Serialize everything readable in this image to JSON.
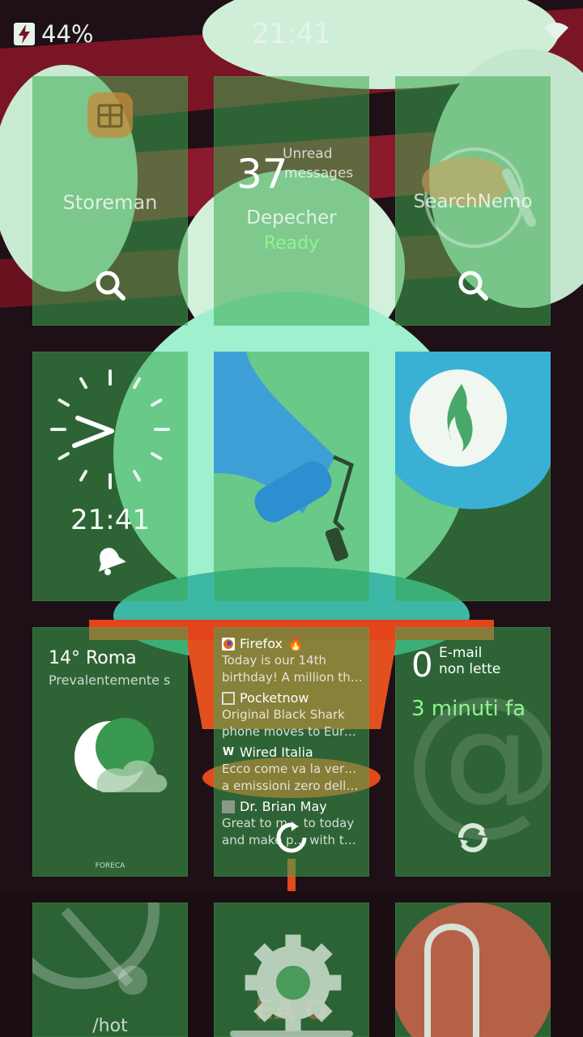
{
  "status_bar": {
    "battery": "44%",
    "time": "21:41"
  },
  "tiles": {
    "storeman": {
      "label": "Storeman"
    },
    "depecher": {
      "count": "37",
      "unread_line1": "Unread",
      "unread_line2": "messages",
      "name": "Depecher",
      "status": "Ready"
    },
    "searchnemo": {
      "label": "SearchNemo"
    },
    "clock": {
      "time": "21:41"
    },
    "weather": {
      "title": "14° Roma",
      "condition": "Prevalentemente s",
      "provider": "FORECA"
    },
    "feed": {
      "items": [
        {
          "source": "Firefox",
          "text1": "Today is our 14th",
          "text2": "birthday! A million than…"
        },
        {
          "source": "Pocketnow",
          "text1": "Original Black Shark",
          "text2": "phone moves to Europ…"
        },
        {
          "source": "Wired Italia",
          "text1": "Ecco come va la versione",
          "text2": "a emissioni zero dell…"
        },
        {
          "source": "Dr. Brian May",
          "text1": "Great to m… to today",
          "text2": "and make p… with th…"
        }
      ]
    },
    "email": {
      "count": "0",
      "line1": "E-mail",
      "line2": "non lette",
      "time": "3 minuti fa"
    },
    "hot": {
      "label": "/hot"
    }
  },
  "colors": {
    "tile": "#3caa50",
    "accent": "#8ef58e"
  }
}
